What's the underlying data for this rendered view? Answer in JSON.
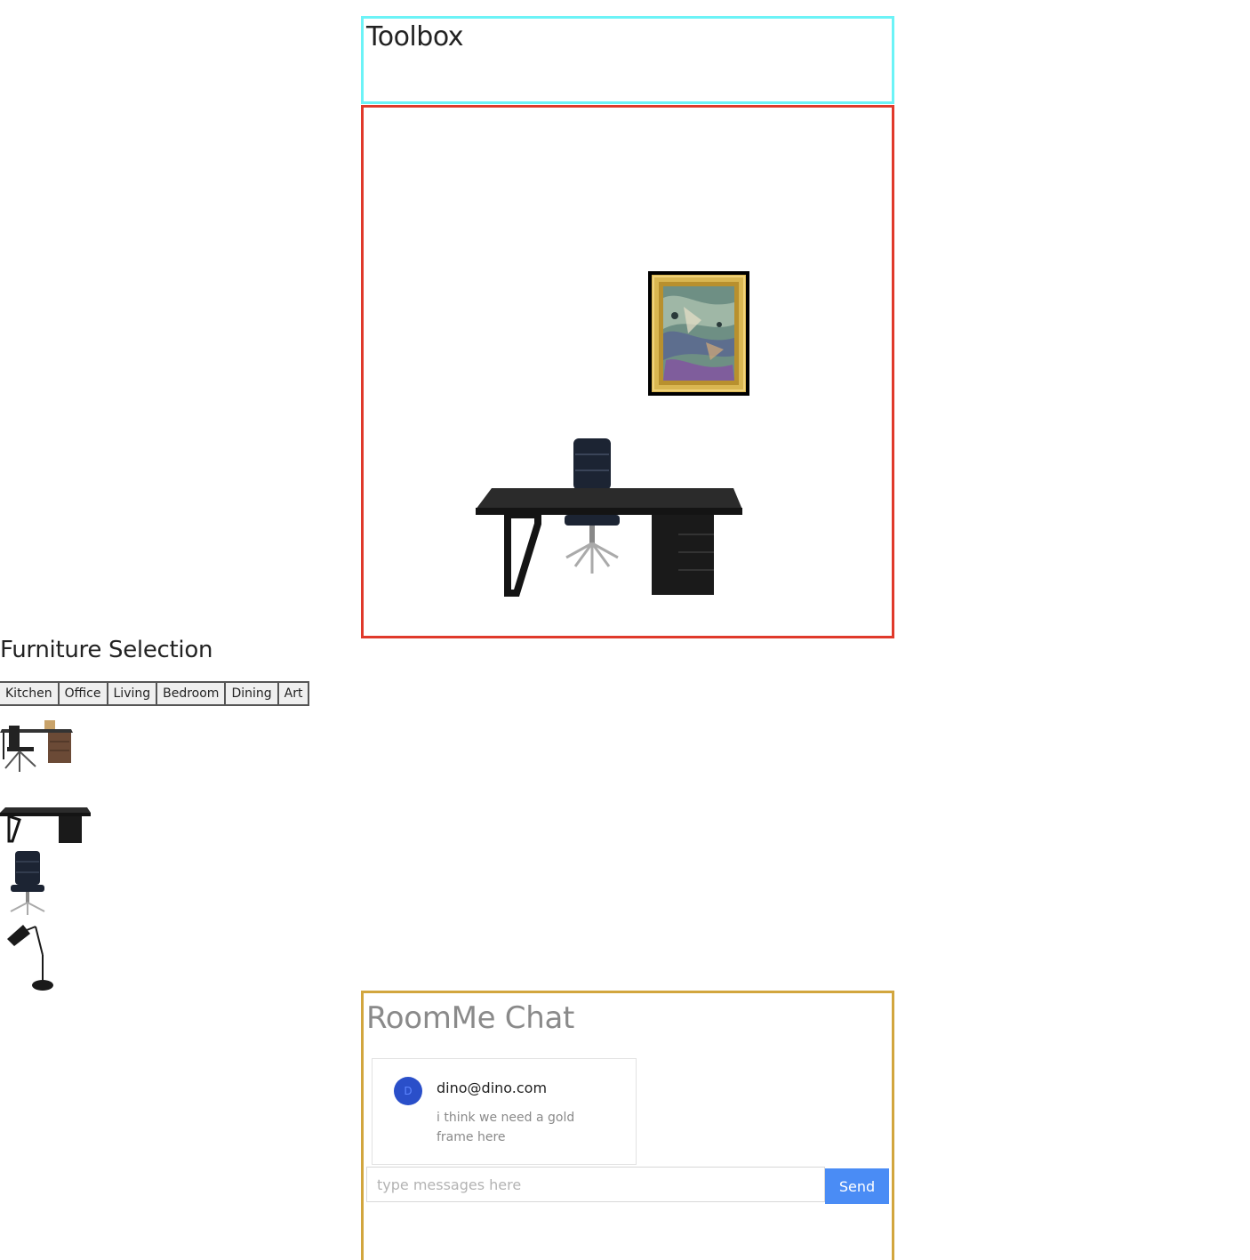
{
  "toolbox": {
    "title": "Toolbox"
  },
  "canvas": {
    "items": [
      {
        "name": "gold-framed-painting"
      },
      {
        "name": "black-desk-with-office-chair"
      }
    ]
  },
  "furniture_selection": {
    "title": "Furniture Selection",
    "tabs": [
      {
        "label": "Kitchen"
      },
      {
        "label": "Office"
      },
      {
        "label": "Living"
      },
      {
        "label": "Bedroom"
      },
      {
        "label": "Dining"
      },
      {
        "label": "Art"
      }
    ],
    "items": [
      {
        "name": "desk-with-chair-and-cabinet"
      },
      {
        "name": "black-desk"
      },
      {
        "name": "office-chair"
      },
      {
        "name": "desk-lamp"
      }
    ]
  },
  "chat": {
    "title": "RoomMe Chat",
    "messages": [
      {
        "avatar_initial": "D",
        "author": "dino@dino.com",
        "text": "i think we need a gold frame here"
      }
    ],
    "input_placeholder": "type messages here",
    "send_label": "Send"
  },
  "colors": {
    "toolbox_border": "#6cf3f7",
    "room_border": "#e0392b",
    "chat_border": "#d2a63e",
    "send_button": "#4a8cf5",
    "avatar": "#2a4fc9"
  }
}
